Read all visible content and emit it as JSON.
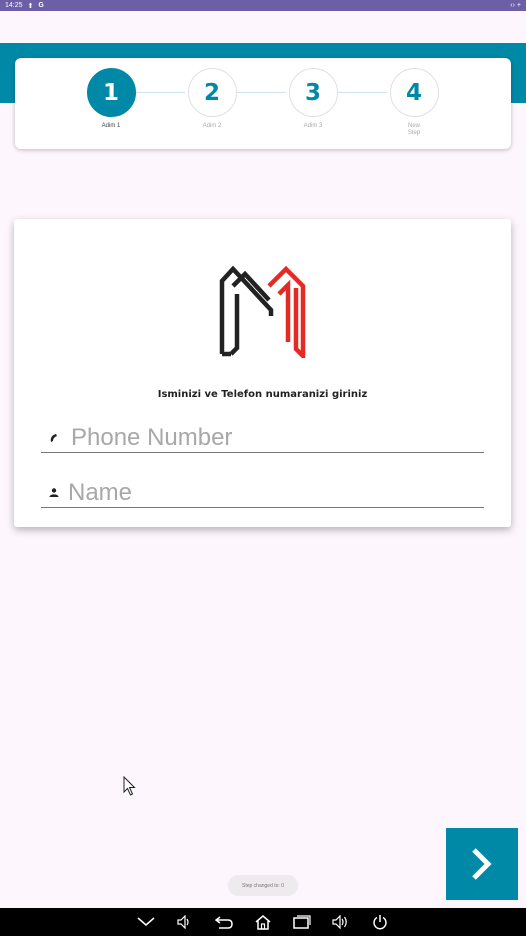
{
  "status_bar": {
    "time": "14:25",
    "app_letter": "G",
    "right_icons": "‹› +"
  },
  "stepper": {
    "steps": [
      {
        "number": "1",
        "label": "Adim 1"
      },
      {
        "number": "2",
        "label": "Adim 2"
      },
      {
        "number": "3",
        "label": "Adim 3"
      },
      {
        "number": "4",
        "label": "New Step"
      }
    ],
    "active_step": 1
  },
  "form": {
    "instruction": "Isminizi ve Telefon numaranizi giriniz",
    "phone": {
      "placeholder": "Phone Number",
      "value": "",
      "icon": "phone-icon"
    },
    "name": {
      "placeholder": "Name",
      "value": "",
      "icon": "person-icon"
    }
  },
  "toast": {
    "text": "Step changed to: 0"
  },
  "next_button": {
    "icon": "chevron-right-icon"
  },
  "nav_bar": {
    "icons": [
      "chevron-down-icon",
      "volume-down-icon",
      "back-icon",
      "home-icon",
      "recents-icon",
      "volume-up-icon",
      "power-icon"
    ]
  },
  "colors": {
    "accent": "#0089a6",
    "status_bar": "#6c5fa7",
    "background": "#fdf6fc",
    "logo_dark": "#222222",
    "logo_red": "#e52a26"
  }
}
